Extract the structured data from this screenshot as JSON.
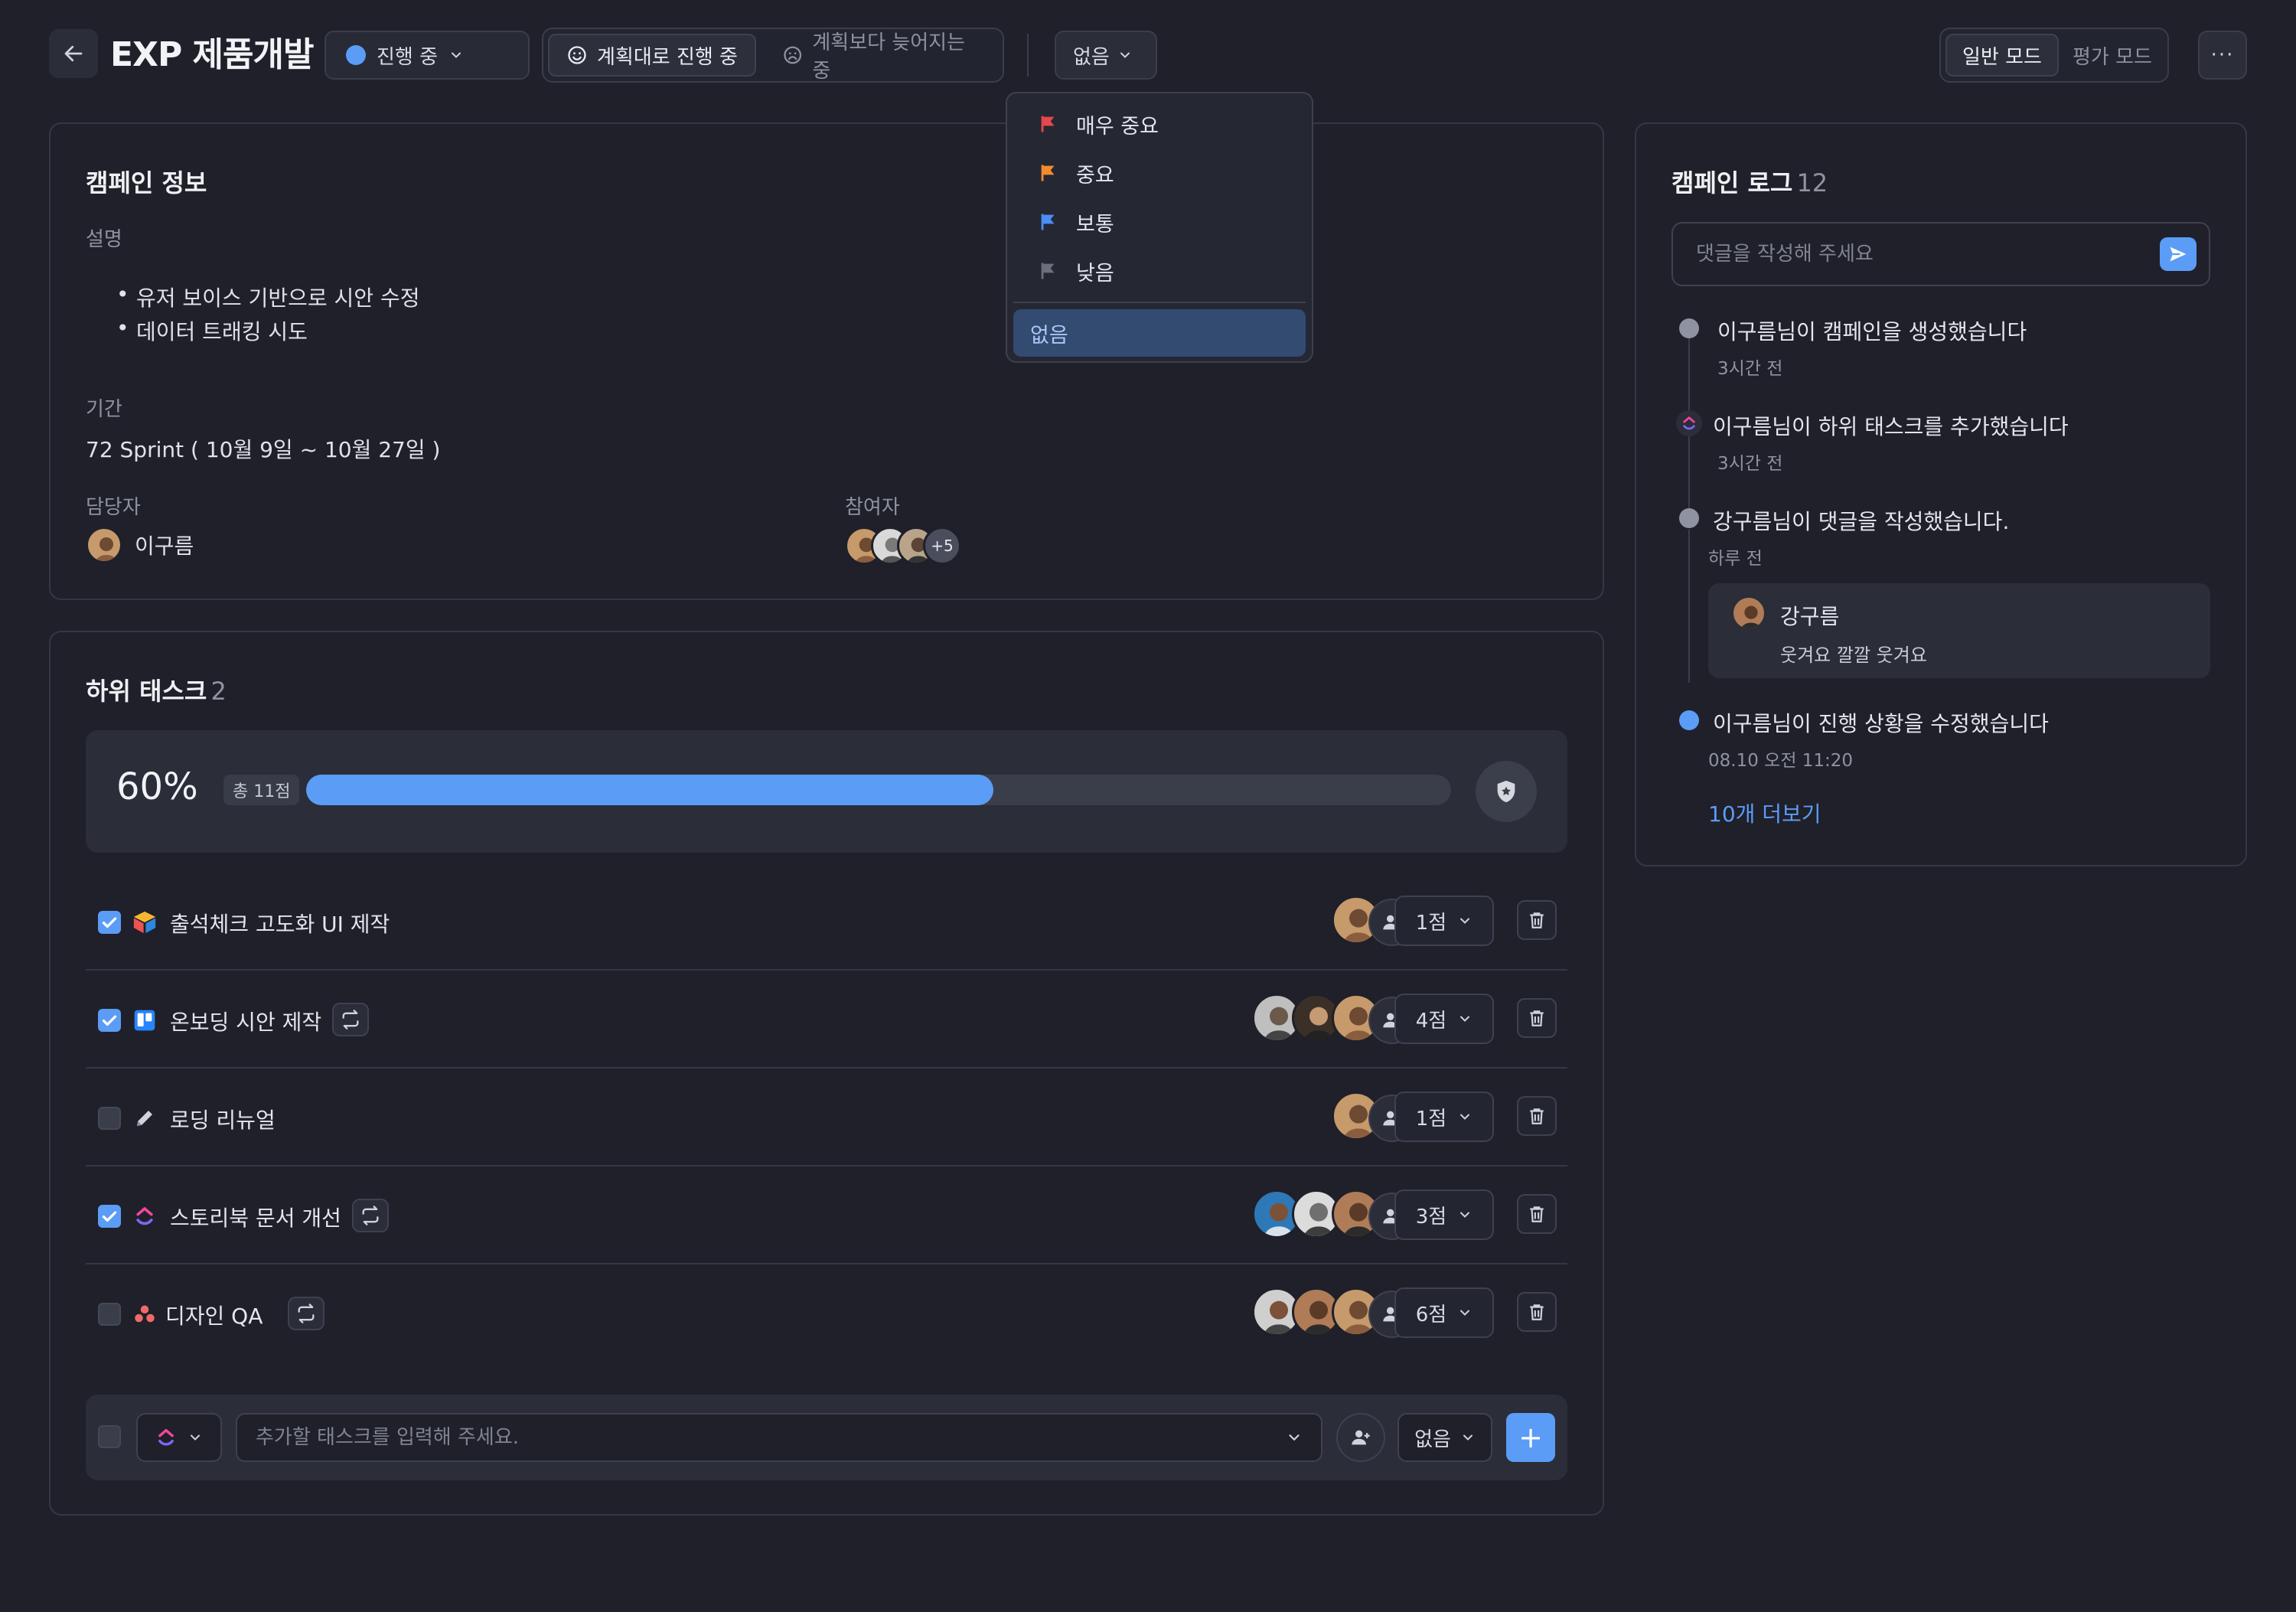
{
  "header": {
    "title": "EXP 제품개발",
    "status": "진행 중",
    "tracking_options": [
      "계획대로 진행 중",
      "계획보다 늦어지는 중"
    ],
    "priority": "없음",
    "modes": [
      "일반 모드",
      "평가 모드"
    ],
    "more": "···"
  },
  "priority_menu": {
    "items": [
      {
        "label": "매우 중요",
        "color": "#e5484d"
      },
      {
        "label": "중요",
        "color": "#f08c2e"
      },
      {
        "label": "보통",
        "color": "#4c8df6"
      },
      {
        "label": "낮음",
        "color": "#6b6f7c"
      }
    ],
    "selected": "없음"
  },
  "info": {
    "title": "캠페인 정보",
    "description_label": "설명",
    "description_items": [
      "유저 보이스 기반으로 시안 수정",
      "데이터 트래킹 시도"
    ],
    "period_label": "기간",
    "period": "72 Sprint ( 10월 9일 ~ 10월 27일 )",
    "owner_label": "담당자",
    "owner": "이구름",
    "participants_label": "참여자",
    "participants_more": "+5"
  },
  "tasks": {
    "title": "하위 태스크",
    "count": "2",
    "progress_text": "60%",
    "progress": 0.6,
    "total_points": "총 11점",
    "items": [
      {
        "name": "출석체크 고도화 UI 제작",
        "checked": true,
        "icon": "cube-icon",
        "repeat": false,
        "avatars": 1,
        "points": "1점"
      },
      {
        "name": "온보딩 시안 제작",
        "checked": true,
        "icon": "trello-icon",
        "repeat": true,
        "avatars": 3,
        "points": "4점"
      },
      {
        "name": "로딩 리뉴얼",
        "checked": false,
        "icon": "pencil-icon",
        "repeat": false,
        "avatars": 1,
        "points": "1점"
      },
      {
        "name": "스토리북 문서 개선",
        "checked": true,
        "icon": "clickup-icon",
        "repeat": true,
        "avatars": 3,
        "points": "3점"
      },
      {
        "name": "디자인 QA",
        "checked": false,
        "icon": "asana-icon",
        "repeat": true,
        "avatars": 3,
        "points": "6점"
      }
    ],
    "add_placeholder": "추가할 태스크를 입력해 주세요.",
    "add_points": "없음",
    "add_button": "+"
  },
  "log": {
    "title": "캠페인 로그",
    "count": "12",
    "comment_placeholder": "댓글을 작성해 주세요",
    "entries": [
      {
        "text": "이구름님이 캠페인을 생성했습니다",
        "time": "3시간 전"
      },
      {
        "text": "이구름님이 하위 태스크를 추가했습니다",
        "time": "3시간 전"
      },
      {
        "text": "강구름님이 댓글을 작성했습니다.",
        "time": "하루 전"
      },
      {
        "text": "이구름님이 진행 상황을 수정했습니다",
        "time": "08.10 오전 11:20"
      }
    ],
    "comment": {
      "author": "강구름",
      "body": "웃겨요 깔깔 웃겨요"
    },
    "more": "10개 더보기"
  },
  "colors": {
    "accent": "#5b9cf6",
    "background": "#1f2029",
    "surface": "#2b2d38"
  }
}
